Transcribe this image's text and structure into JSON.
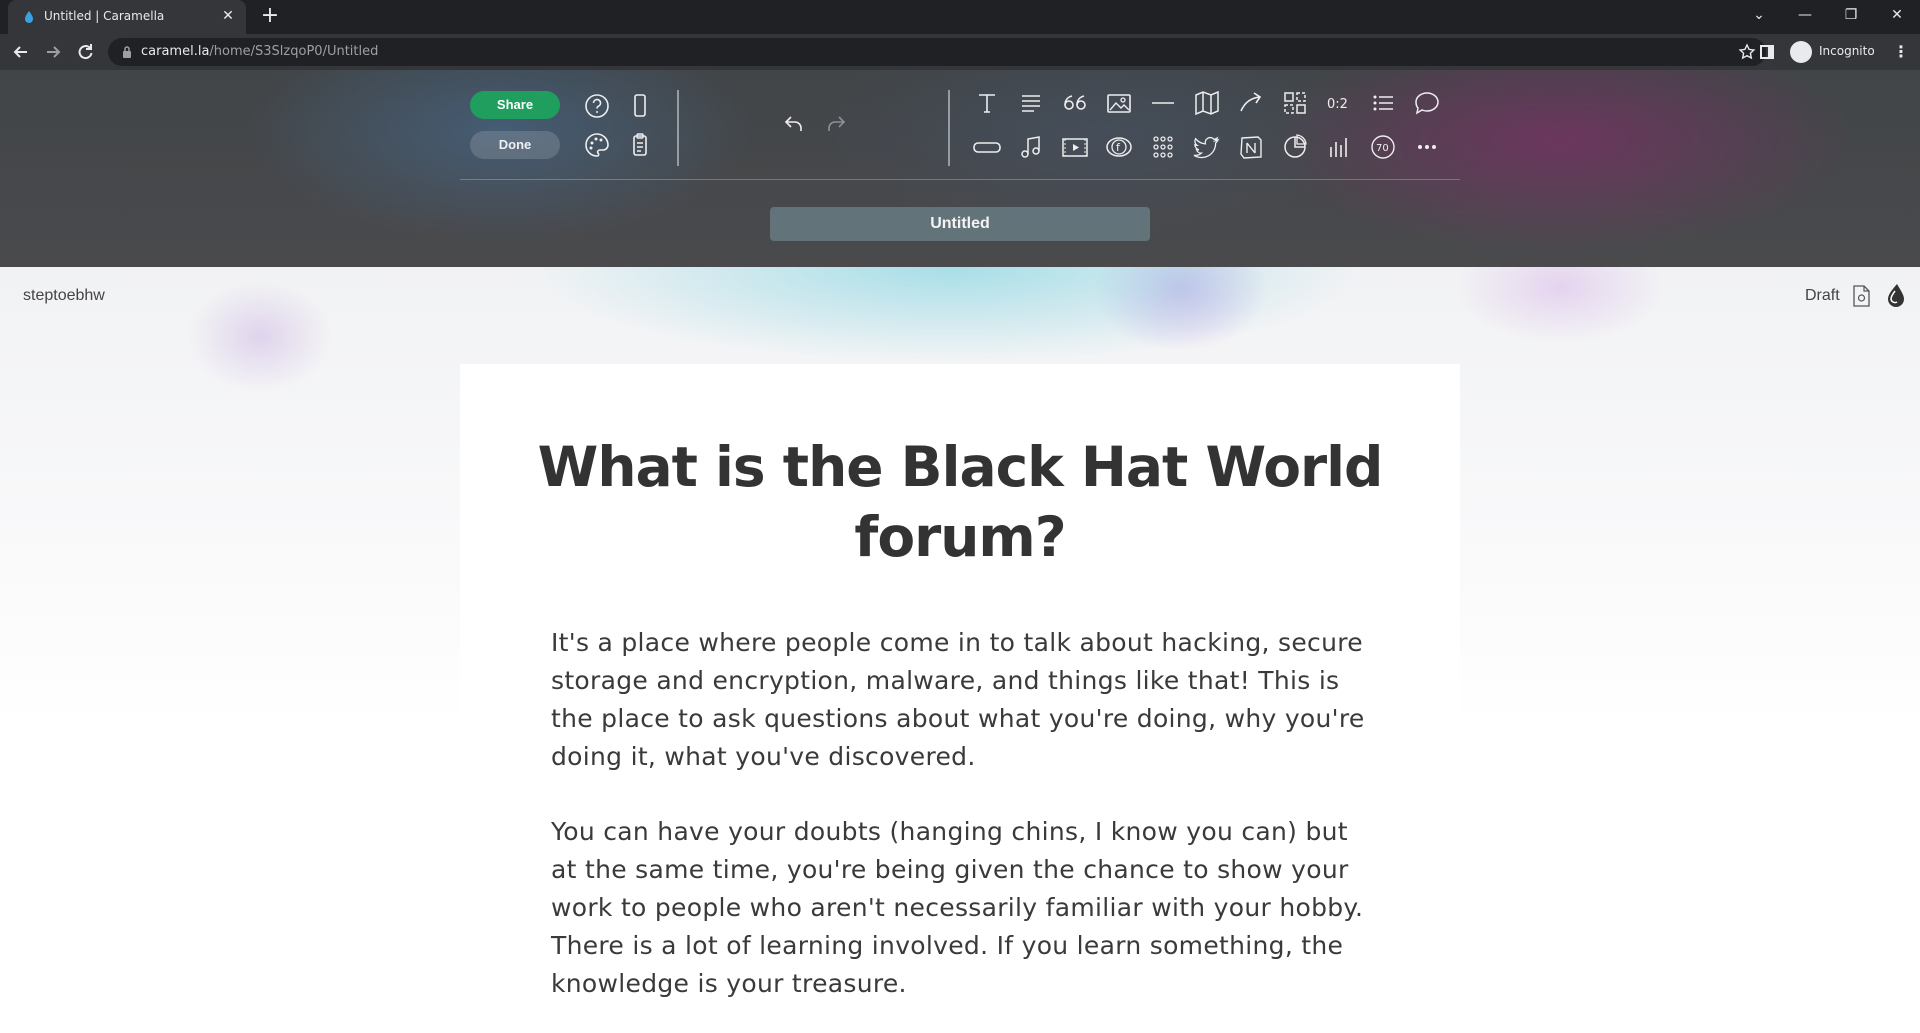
{
  "browser": {
    "tab_title": "Untitled | Caramella",
    "url_domain": "caramel.la",
    "url_path": "/home/S3SlzqoP0/Untitled",
    "profile_label": "Incognito"
  },
  "toolbar": {
    "share_label": "Share",
    "done_label": "Done",
    "video_count_label": "70",
    "accent_color": "#1f9e5e"
  },
  "document": {
    "title_bar": "Untitled",
    "username": "steptoebhw",
    "status": "Draft",
    "heading": "What is the Black Hat World forum?",
    "paragraphs": [
      "It's a place where people come in to talk about hacking, secure storage and encryption, malware, and things like that! This is the place to ask questions about what you're doing, why you're doing it, what you've discovered.",
      "You can have your doubts (hanging chins, I know you can) but at the same time, you're being given the chance to show your work to people who aren't necessarily familiar with your hobby. There is a lot of learning involved. If you learn something, the knowledge is your treasure."
    ]
  }
}
